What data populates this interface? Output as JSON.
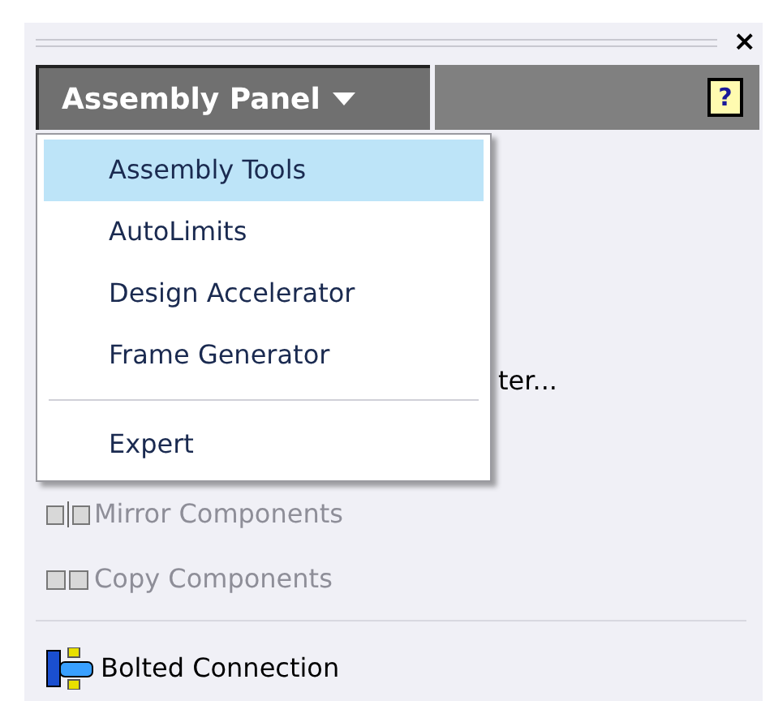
{
  "panel": {
    "title": "Assembly Panel",
    "close": "×",
    "help": "?"
  },
  "menu": {
    "items": [
      {
        "label": "Assembly Tools",
        "selected": true,
        "separator_before": false
      },
      {
        "label": "AutoLimits",
        "selected": false,
        "separator_before": false
      },
      {
        "label": "Design Accelerator",
        "selected": false,
        "separator_before": false
      },
      {
        "label": "Frame Generator",
        "selected": false,
        "separator_before": false
      },
      {
        "label": "Expert",
        "selected": false,
        "separator_before": true
      }
    ]
  },
  "tools": [
    {
      "label": "ter...",
      "disabled": false,
      "kind": "partial",
      "separator_before": false
    },
    {
      "label": "Mirror Components",
      "disabled": true,
      "kind": "mirror",
      "separator_before": false
    },
    {
      "label": "Copy Components",
      "disabled": true,
      "kind": "copy",
      "separator_before": false
    },
    {
      "label": "Bolted Connection",
      "disabled": false,
      "kind": "bolt",
      "separator_before": true
    }
  ]
}
